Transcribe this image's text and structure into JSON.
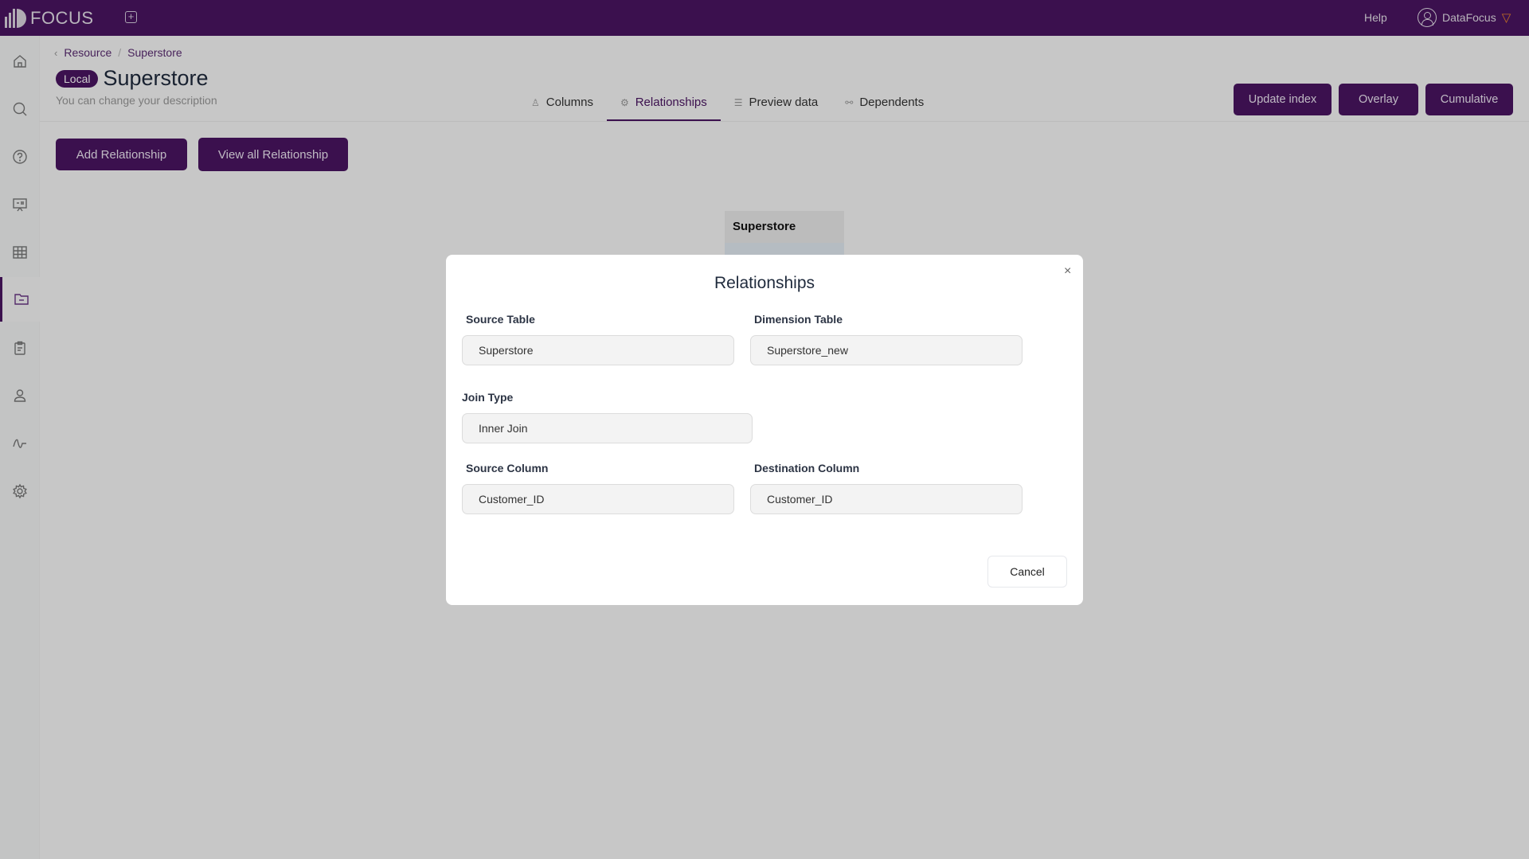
{
  "app": {
    "logo_text": "FOCUS",
    "brand_color": "#4a1462",
    "new_tab_icon": "plus-square-icon"
  },
  "topbar": {
    "help_label": "Help",
    "user_name": "DataFocus",
    "user_icon": "user-circle-icon",
    "badge_icon": "diamond-icon"
  },
  "sidebar": {
    "active_index": 5,
    "items": [
      {
        "name": "home",
        "icon": "home-icon"
      },
      {
        "name": "search",
        "icon": "search-icon"
      },
      {
        "name": "question",
        "icon": "question-circle-icon"
      },
      {
        "name": "presentation",
        "icon": "presentation-icon"
      },
      {
        "name": "table",
        "icon": "grid-icon"
      },
      {
        "name": "resources",
        "icon": "folder-icon"
      },
      {
        "name": "clipboard",
        "icon": "clipboard-icon"
      },
      {
        "name": "users",
        "icon": "user-icon"
      },
      {
        "name": "monitor",
        "icon": "pulse-icon"
      },
      {
        "name": "settings",
        "icon": "gear-icon"
      }
    ]
  },
  "breadcrumb": {
    "back_icon": "chevron-left-icon",
    "items": [
      "Resource",
      "Superstore"
    ],
    "separator": "/"
  },
  "header": {
    "badge": "Local",
    "title": "Superstore",
    "description": "You can change your description"
  },
  "tabs": [
    {
      "label": "Columns",
      "icon": "user-icon",
      "glyph": "♙",
      "active": false
    },
    {
      "label": "Relationships",
      "icon": "gear-icon",
      "glyph": "⚙",
      "active": true
    },
    {
      "label": "Preview data",
      "icon": "database-icon",
      "glyph": "☰",
      "active": false
    },
    {
      "label": "Dependents",
      "icon": "link-icon",
      "glyph": "⚯",
      "active": false
    }
  ],
  "actions": {
    "update_index": "Update index",
    "overlay": "Overlay",
    "cumulative": "Cumulative",
    "add_relationship": "Add Relationship",
    "view_all_relationship": "View all Relationship"
  },
  "canvas": {
    "node_title": "Superstore"
  },
  "modal": {
    "title": "Relationships",
    "close_glyph": "×",
    "fields": {
      "source_table": {
        "label": "Source Table",
        "value": "Superstore"
      },
      "dimension_table": {
        "label": "Dimension Table",
        "value": "Superstore_new"
      },
      "join_type": {
        "label": "Join Type",
        "value": "Inner Join"
      },
      "source_column": {
        "label": "Source Column",
        "value": "Customer_ID"
      },
      "destination_column": {
        "label": "Destination Column",
        "value": "Customer_ID"
      }
    },
    "cancel_label": "Cancel"
  }
}
